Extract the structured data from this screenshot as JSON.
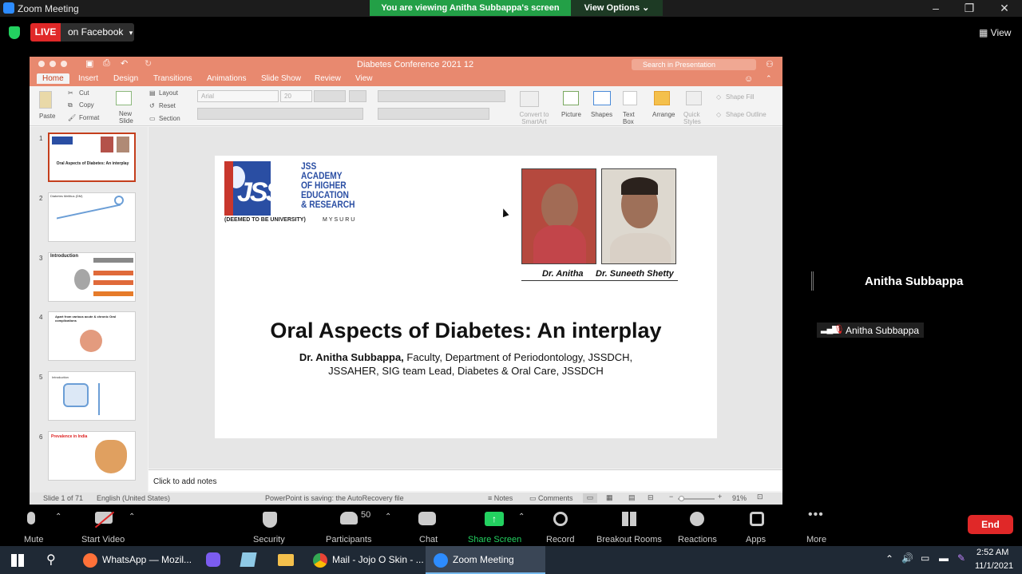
{
  "zoom": {
    "window_title": "Zoom Meeting",
    "viewing_banner": "You are viewing Anitha Subbappa's screen",
    "view_options": "View Options ⌄",
    "live_label": "LIVE",
    "live_platform": "on Facebook",
    "view_label": "View",
    "speaker_name": "Anitha Subbappa",
    "participant_label": "Anitha Subbappa",
    "toolbar": {
      "mute": "Mute",
      "start_video": "Start Video",
      "security": "Security",
      "participants": "Participants",
      "participants_count": "50",
      "chat": "Chat",
      "share_screen": "Share Screen",
      "record": "Record",
      "breakout_rooms": "Breakout Rooms",
      "reactions": "Reactions",
      "apps": "Apps",
      "more": "More",
      "end": "End"
    },
    "colors": {
      "live": "#e02828",
      "banner": "#23a047",
      "share": "#23d160"
    }
  },
  "ppt": {
    "doc_title": "Diabetes Conference 2021 12",
    "search_placeholder": "Search in Presentation",
    "tabs": [
      "Home",
      "Insert",
      "Design",
      "Transitions",
      "Animations",
      "Slide Show",
      "Review",
      "View"
    ],
    "ribbon": {
      "paste": "Paste",
      "cut": "Cut",
      "copy": "Copy",
      "format": "Format",
      "new_slide": "New Slide",
      "layout": "Layout",
      "reset": "Reset",
      "section": "Section",
      "font": "Arial",
      "font_size": "20",
      "convert": "Convert to SmartArt",
      "picture": "Picture",
      "shapes": "Shapes",
      "text_box": "Text Box",
      "arrange": "Arrange",
      "quick_styles": "Quick Styles",
      "shape_fill": "Shape Fill",
      "shape_outline": "Shape Outline"
    },
    "thumbnails": [
      {
        "num": "1",
        "title": "Oral Aspects of Diabetes: An interplay"
      },
      {
        "num": "2",
        "title": "Diabetes Mellitus (DM)"
      },
      {
        "num": "3",
        "title": "Introduction"
      },
      {
        "num": "4",
        "title": "Apart from various acute & chronic Oral complications"
      },
      {
        "num": "5",
        "title": "Introduction"
      },
      {
        "num": "6",
        "title": "Prevalence in India"
      }
    ],
    "slide": {
      "logo_text": "JSS",
      "logo_lines": [
        "JSS",
        "ACADEMY",
        "OF HIGHER",
        "EDUCATION",
        "& RESEARCH"
      ],
      "logo_sub": "(DEEMED TO BE UNIVERSITY)",
      "logo_city": "MYSURU",
      "person1": "Dr. Anitha",
      "person2": "Dr. Suneeth Shetty",
      "title": "Oral Aspects of Diabetes: An interplay",
      "author_bold": "Dr. Anitha Subbappa,",
      "author_rest": " Faculty, Department of Periodontology, JSSDCH,",
      "author_line2": "JSSAHER, SIG team Lead, Diabetes & Oral Care, JSSDCH"
    },
    "notes_placeholder": "Click to add notes",
    "status": {
      "slide_of": "Slide 1 of 71",
      "language": "English (United States)",
      "saving": "PowerPoint is saving: the AutoRecovery file",
      "notes": "Notes",
      "comments": "Comments",
      "zoom": "91%"
    },
    "colors": {
      "accent": "#e8896f",
      "tab_active": "#c43e1c"
    }
  },
  "taskbar": {
    "items": [
      "WhatsApp — Mozil...",
      "Mail - Jojo O Skin - ...",
      "Zoom Meeting"
    ],
    "time": "2:52 AM",
    "date": "11/1/2021"
  }
}
